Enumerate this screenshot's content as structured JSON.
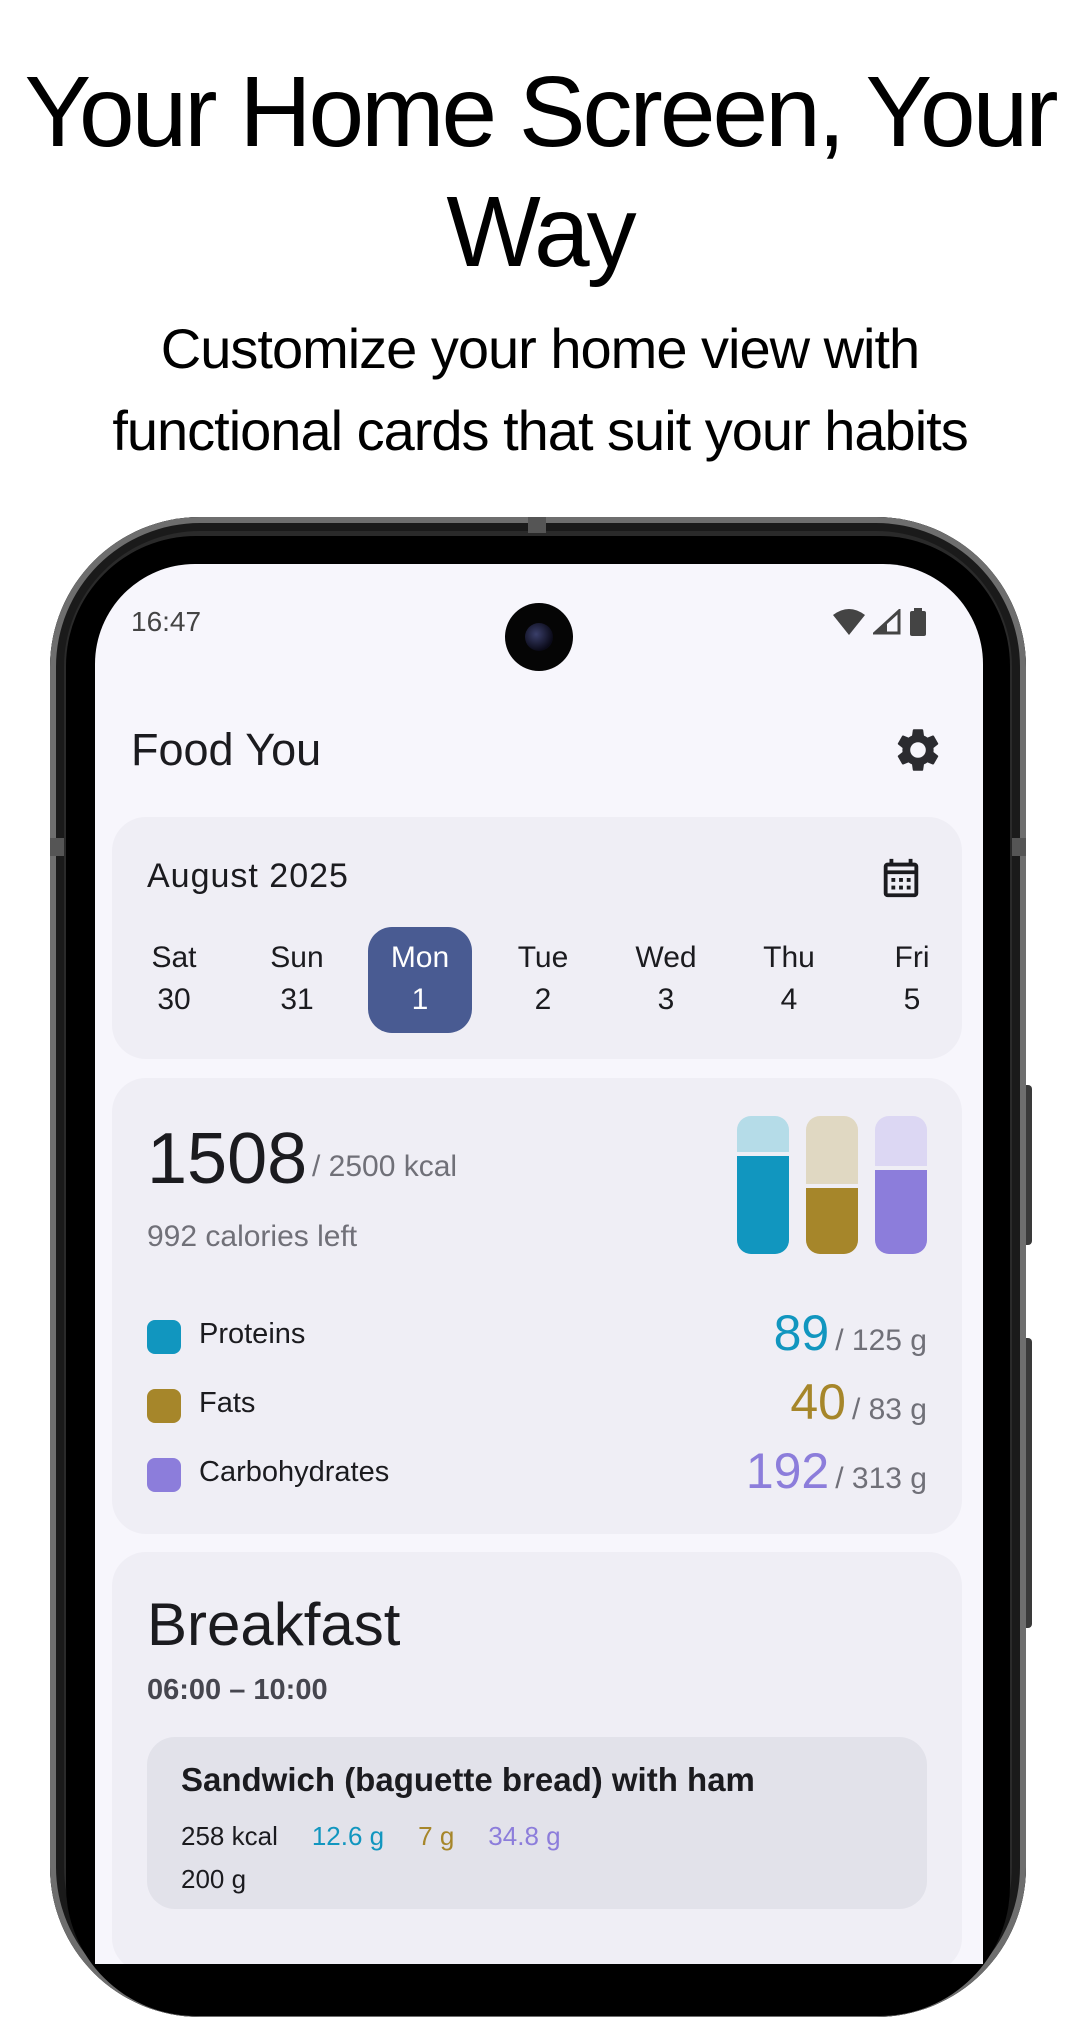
{
  "promo": {
    "title": "Your Home Screen, Your Way",
    "subtitle": "Customize your home view with functional cards that suit your habits"
  },
  "status_bar": {
    "time": "16:47",
    "icons": [
      "wifi-icon",
      "signal-icon",
      "battery-icon"
    ]
  },
  "app": {
    "title": "Food You",
    "settings_icon": "gear-icon"
  },
  "calendar": {
    "month": "August 2025",
    "icon": "calendar-icon",
    "days": [
      {
        "weekday": "Sat",
        "date": "30",
        "selected": false
      },
      {
        "weekday": "Sun",
        "date": "31",
        "selected": false
      },
      {
        "weekday": "Mon",
        "date": "1",
        "selected": true
      },
      {
        "weekday": "Tue",
        "date": "2",
        "selected": false
      },
      {
        "weekday": "Wed",
        "date": "3",
        "selected": false
      },
      {
        "weekday": "Thu",
        "date": "4",
        "selected": false
      },
      {
        "weekday": "Fri",
        "date": "5",
        "selected": false
      }
    ]
  },
  "summary": {
    "calories": "1508",
    "goal": "/ 2500 kcal",
    "left": "992 calories left",
    "macros": [
      {
        "name": "Proteins",
        "value": "89",
        "goal": "/ 125 g",
        "color": "#1196bf",
        "light": "#b5dce8",
        "fraction": 0.71
      },
      {
        "name": "Fats",
        "value": "40",
        "goal": "/ 83 g",
        "color": "#a6862a",
        "light": "#e0d8c2",
        "fraction": 0.48
      },
      {
        "name": "Carbohydrates",
        "value": "192",
        "goal": "/ 313 g",
        "color": "#8c7ddb",
        "light": "#dcd7f3",
        "fraction": 0.61
      }
    ]
  },
  "meal": {
    "title": "Breakfast",
    "time": "06:00 – 10:00",
    "items": [
      {
        "name": "Sandwich (baguette bread) with ham",
        "kcal": "258 kcal",
        "proteins": "12.6 g",
        "fats": "7 g",
        "carbs": "34.8 g",
        "weight": "200 g"
      }
    ]
  },
  "colors": {
    "accent": "#495b92",
    "screen_bg": "#f7f6fc",
    "card_bg": "#efeef5"
  }
}
